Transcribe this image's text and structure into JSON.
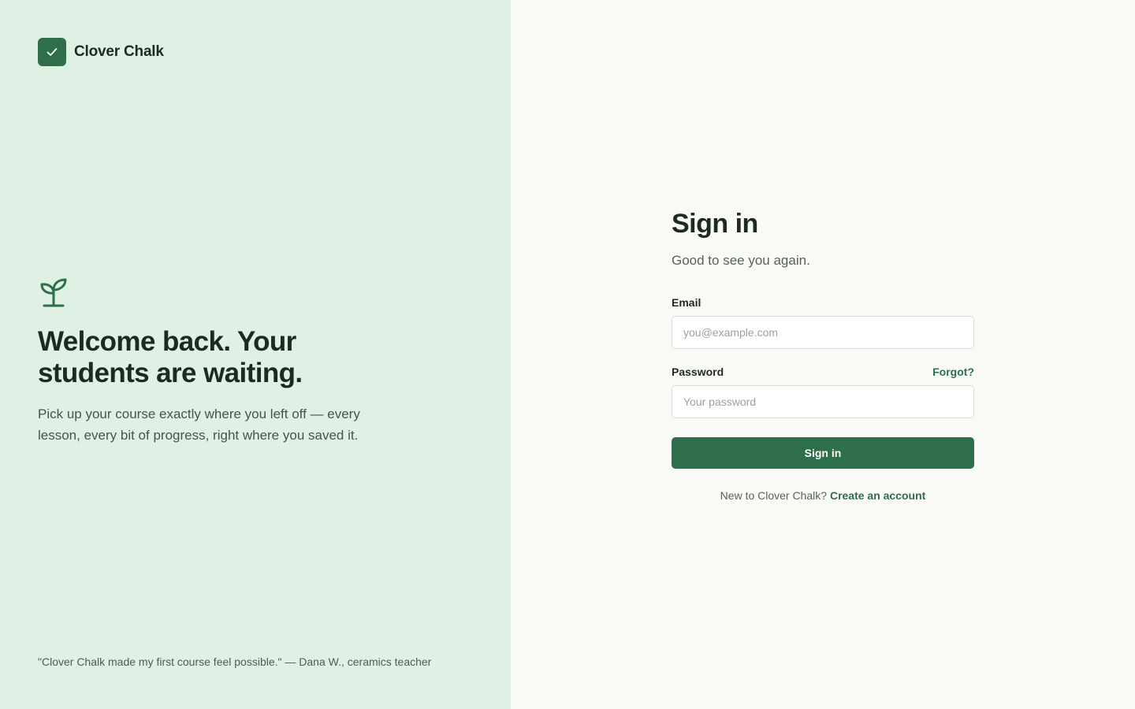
{
  "brand": {
    "name": "Clover Chalk",
    "icon": "check-icon",
    "accent_color": "#2f6e4b"
  },
  "hero": {
    "icon": "sprout-icon",
    "title": "Welcome back. Your students are waiting.",
    "body": "Pick up your course exactly where you left off — every lesson, every bit of progress, right where you saved it.",
    "testimonial": "\"Clover Chalk made my first course feel possible.\" — Dana W., ceramics teacher"
  },
  "form": {
    "title": "Sign in",
    "subtitle": "Good to see you again.",
    "email": {
      "label": "Email",
      "value": "",
      "placeholder": "you@example.com"
    },
    "password": {
      "label": "Password",
      "value": "",
      "placeholder": "Your password",
      "forgot_label": "Forgot?"
    },
    "submit_label": "Sign in",
    "signup_prompt": "New to Clover Chalk?",
    "signup_link": "Create an account"
  },
  "colors": {
    "left_panel_bg": "#dff0e4",
    "right_panel_bg": "#f9faf6",
    "primary": "#2f6e4b"
  }
}
